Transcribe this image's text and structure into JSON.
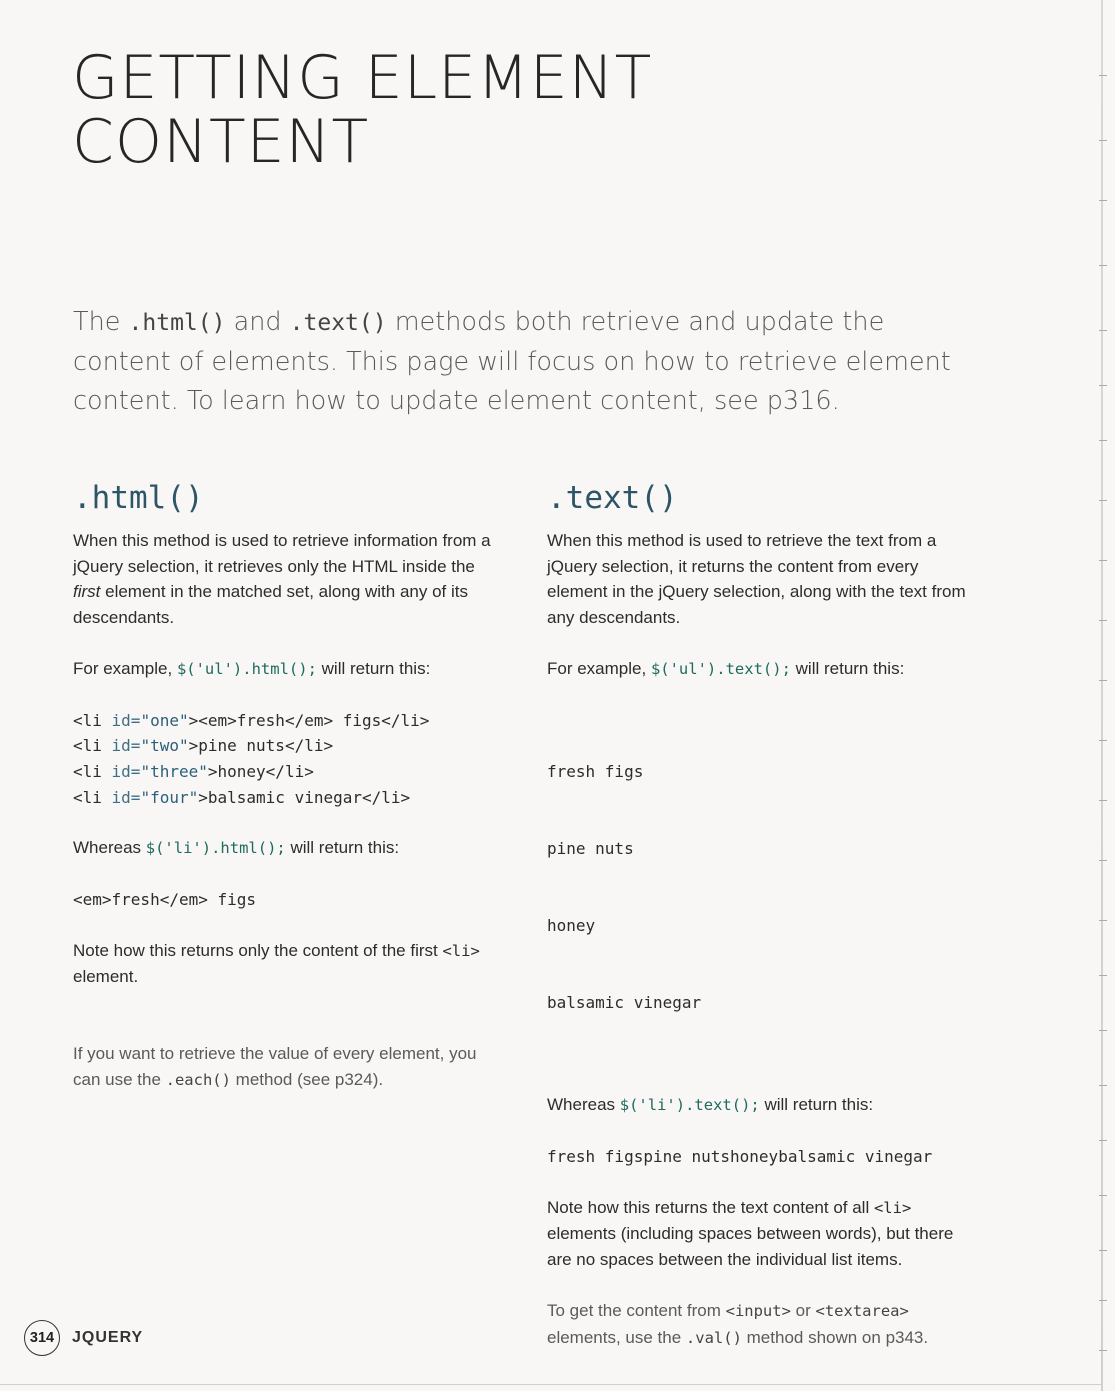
{
  "title": {
    "line1": "GETTING ELEMENT",
    "line2": "CONTENT"
  },
  "intro": {
    "t1": "The ",
    "c1": ".html()",
    "t2": " and ",
    "c2": ".text()",
    "t3": " methods both retrieve and update the content of elements. This page will focus on how to retrieve element content. To learn how to update element content, see p316."
  },
  "html_col": {
    "heading": ".html()",
    "desc_a": "When this method is used to retrieve information from a jQuery selection, it retrieves only the HTML inside the ",
    "desc_em": "first",
    "desc_b": " element in the matched set, along with any of its descendants.",
    "example_prefix": "For example, ",
    "example_code": "$('ul').html();",
    "example_suffix": " will return this:",
    "code_lines": [
      {
        "open": "<li ",
        "attr": "id=",
        "val": "\"one\"",
        "rest": "><em>fresh</em> figs</li>"
      },
      {
        "open": "<li ",
        "attr": "id=",
        "val": "\"two\"",
        "rest": ">pine nuts</li>"
      },
      {
        "open": "<li ",
        "attr": "id=",
        "val": "\"three\"",
        "rest": ">honey</li>"
      },
      {
        "open": "<li ",
        "attr": "id=",
        "val": "\"four\"",
        "rest": ">balsamic vinegar</li>"
      }
    ],
    "whereas_prefix": "Whereas ",
    "whereas_code": "$('li').html();",
    "whereas_suffix": " will return this:",
    "result": "<em>fresh</em> figs",
    "note_a": "Note how this returns only the content of the first ",
    "note_code": "<li>",
    "note_b": " element.",
    "tip_a": "If you want to retrieve the value of every element, you can use the ",
    "tip_code": ".each()",
    "tip_b": " method (see p324)."
  },
  "text_col": {
    "heading": ".text()",
    "desc": "When this method is used to retrieve the text from a jQuery selection, it returns the content from every element in the jQuery selection, along with the text from any descendants.",
    "example_prefix": "For example, ",
    "example_code": "$('ul').text();",
    "example_suffix": " will return this:",
    "code_lines": [
      "fresh figs",
      "pine nuts",
      "honey",
      "balsamic vinegar"
    ],
    "whereas_prefix": "Whereas ",
    "whereas_code": "$('li').text();",
    "whereas_suffix": " will return this:",
    "result": "fresh figspine nutshoneybalsamic vinegar",
    "note_a": "Note how this returns the text content of all ",
    "note_code": "<li>",
    "note_b": " elements (including spaces between words), but there are no spaces between the individual list items.",
    "tip_a": "To get the content from ",
    "tip_code1": "<input>",
    "tip_mid": " or ",
    "tip_code2": "<textarea>",
    "tip_b": " elements, use the ",
    "tip_code3": ".val()",
    "tip_c": " method shown on p343."
  },
  "footer": {
    "page_number": "314",
    "section": "JQUERY"
  }
}
